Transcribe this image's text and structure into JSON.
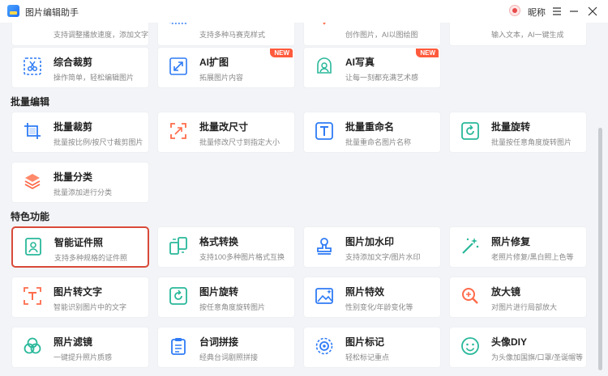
{
  "app": {
    "title": "图片编辑助手",
    "user_name": "昵称"
  },
  "cards_top": [
    {
      "name": "",
      "desc": "支持调整播放速度，添加文字"
    },
    {
      "name": "",
      "desc": "支持多种马赛克样式"
    },
    {
      "name": "",
      "desc": "创作图片，AI以图绘图"
    },
    {
      "name": "",
      "desc": "输入文本，AI一键生成"
    }
  ],
  "cards_row1": [
    {
      "name": "综合裁剪",
      "desc": "操作简单，轻松编辑图片",
      "icon": "crop-scissors-icon"
    },
    {
      "name": "AI扩图",
      "desc": "拓展图片内容",
      "icon": "expand-arrows-icon",
      "badge": "NEW"
    },
    {
      "name": "AI写真",
      "desc": "让每一刻都充满艺术感",
      "icon": "portrait-frame-icon",
      "badge": "NEW"
    }
  ],
  "sections": {
    "batch": {
      "title": "批量编辑",
      "cards": [
        {
          "name": "批量裁剪",
          "desc": "批量按比例/按尺寸裁剪图片",
          "icon": "batch-crop-icon"
        },
        {
          "name": "批量改尺寸",
          "desc": "批量修改尺寸到指定大小",
          "icon": "resize-arrows-icon"
        },
        {
          "name": "批量重命名",
          "desc": "批量重命名图片名称",
          "icon": "rename-text-icon"
        },
        {
          "name": "批量旋转",
          "desc": "批量按任意角度旋转图片",
          "icon": "rotate-icon"
        },
        {
          "name": "批量分类",
          "desc": "批量添加进行分类",
          "icon": "layers-icon"
        }
      ]
    },
    "special": {
      "title": "特色功能",
      "cards": [
        {
          "name": "智能证件照",
          "desc": "支持多种规格的证件照",
          "icon": "id-photo-icon"
        },
        {
          "name": "格式转换",
          "desc": "支持100多种图片格式互换",
          "icon": "convert-icon"
        },
        {
          "name": "图片加水印",
          "desc": "支持添加文字/图片水印",
          "icon": "stamp-icon"
        },
        {
          "name": "照片修复",
          "desc": "老照片修复/黑白照上色等",
          "icon": "magic-wand-icon"
        },
        {
          "name": "图片转文字",
          "desc": "智能识别图片中的文字",
          "icon": "ocr-text-icon"
        },
        {
          "name": "图片旋转",
          "desc": "按任意角度旋转图片",
          "icon": "rotate-icon"
        },
        {
          "name": "照片特效",
          "desc": "性别变化/年龄变化等",
          "icon": "photo-effect-icon"
        },
        {
          "name": "放大镜",
          "desc": "对图片进行局部放大",
          "icon": "magnifier-icon"
        },
        {
          "name": "照片滤镜",
          "desc": "一键提升照片质感",
          "icon": "filter-circles-icon"
        },
        {
          "name": "台词拼接",
          "desc": "经典台词剧照拼接",
          "icon": "clipboard-icon"
        },
        {
          "name": "图片标记",
          "desc": "轻松标记重点",
          "icon": "target-mark-icon"
        },
        {
          "name": "头像DIY",
          "desc": "为头像加国旗/口罩/圣诞帽等",
          "icon": "smiley-icon"
        }
      ]
    }
  },
  "colors": {
    "accent": "#2f7bf5",
    "badge": "#ff5a3c",
    "highlight": "#d84a3a"
  }
}
